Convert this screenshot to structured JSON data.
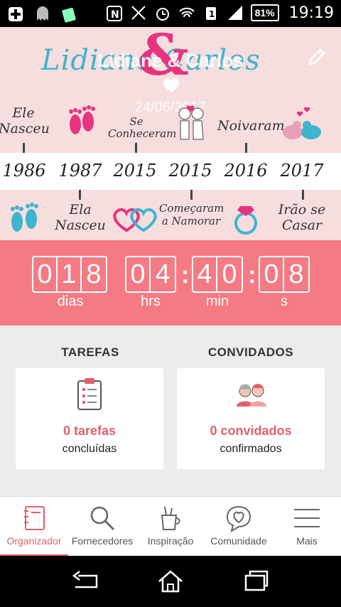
{
  "status_bar": {
    "battery": "81%",
    "time": "19:19"
  },
  "header": {
    "names_script": "Lidiane    Carlos",
    "ampersand": "&",
    "names_overlay": "Lidiane & Carlos",
    "date": "24/06/2017"
  },
  "timeline": {
    "top_events": [
      "Ele Nasceu",
      "Se Conheceram",
      "Noivaram"
    ],
    "years": [
      "1986",
      "1987",
      "2015",
      "2015",
      "2016",
      "2017"
    ],
    "bottom_events": [
      "Ela Nasceu",
      "Começaram a Namorar",
      "Irão se Casar"
    ]
  },
  "countdown": {
    "days": [
      "0",
      "1",
      "8"
    ],
    "hours": [
      "0",
      "4"
    ],
    "minutes": [
      "4",
      "0"
    ],
    "seconds": [
      "0",
      "8"
    ],
    "units": {
      "days": "dias",
      "hours": "hrs",
      "minutes": "min",
      "seconds": "s"
    }
  },
  "sections": {
    "tasks": {
      "title": "TAREFAS",
      "count": "0 tarefas",
      "desc": "concluídas"
    },
    "guests": {
      "title": "CONVIDADOS",
      "count": "0 convidados",
      "desc": "confirmados"
    }
  },
  "bottom_nav": [
    {
      "label": "Organizador",
      "icon": "notebook-icon",
      "active": true
    },
    {
      "label": "Fornecedores",
      "icon": "search-icon",
      "active": false
    },
    {
      "label": "Inspiração",
      "icon": "cup-icon",
      "active": false
    },
    {
      "label": "Comunidade",
      "icon": "chat-heart-icon",
      "active": false
    },
    {
      "label": "Mais",
      "icon": "menu-icon",
      "active": false
    }
  ],
  "colors": {
    "accent": "#e0616b",
    "countdown_bg": "#f57a83",
    "header_bg": "#f7dede",
    "script_blue": "#3fb4cf",
    "script_pink": "#e8337e"
  }
}
